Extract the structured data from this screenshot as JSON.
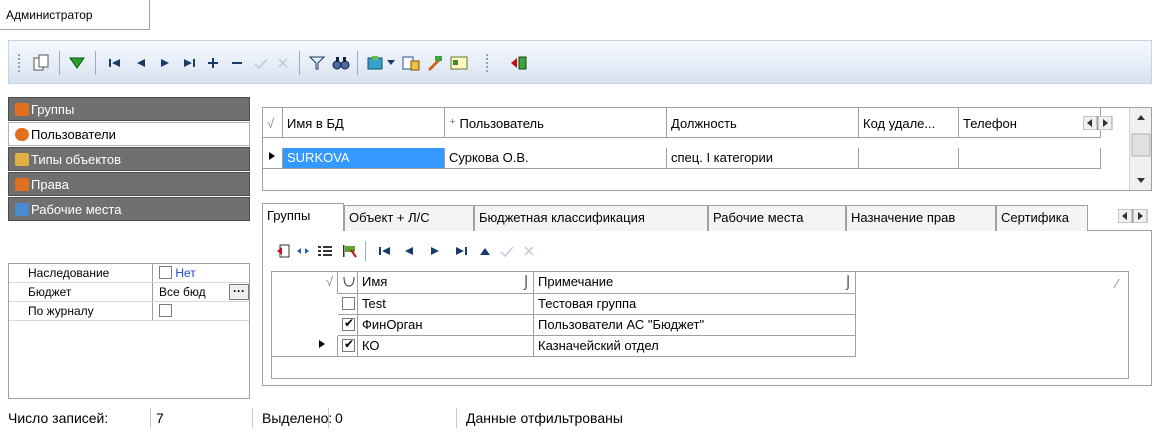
{
  "top_tab": "Администратор",
  "nav": {
    "items": [
      {
        "label": "Группы",
        "active": false
      },
      {
        "label": "Пользователи",
        "active": true
      },
      {
        "label": "Типы объектов",
        "active": false
      },
      {
        "label": "Права",
        "active": false
      },
      {
        "label": "Рабочие места",
        "active": false
      }
    ]
  },
  "props": {
    "rows": [
      {
        "name": "Наследование",
        "value": "Нет"
      },
      {
        "name": "Бюджет",
        "value": "Все бюд"
      },
      {
        "name": "По журналу",
        "value": ""
      }
    ],
    "ellipsis": "···"
  },
  "users_grid": {
    "headers": [
      "Имя в БД",
      "Пользователь",
      "Должность",
      "Код удале...",
      "Телефон"
    ],
    "rows": [
      {
        "db_name": "SURKOVA",
        "user": "Суркова О.В.",
        "position": "спец. I категории",
        "code": "",
        "phone": ""
      }
    ]
  },
  "tabs": [
    "Группы",
    "Объект + Л/С",
    "Бюджетная классификация",
    "Рабочие места",
    "Назначение прав",
    "Сертифика"
  ],
  "groups_grid": {
    "headers": [
      "Имя",
      "Примечание"
    ],
    "rows": [
      {
        "checked": false,
        "name": "Test",
        "note": "Тестовая группа"
      },
      {
        "checked": true,
        "name": "ФинОрган",
        "note": "Пользователи АС \"Бюджет\""
      },
      {
        "checked": true,
        "name": "КО",
        "note": "Казначейский отдел"
      }
    ]
  },
  "status": {
    "records_label": "Число записей:",
    "records_value": "7",
    "selected_label": "Выделено:",
    "selected_value": "0",
    "filter_text": "Данные отфильтрованы"
  },
  "colors": {
    "selection": "#3399ff",
    "nav_inactive": "#707070",
    "add_icon": "#d0101a"
  }
}
